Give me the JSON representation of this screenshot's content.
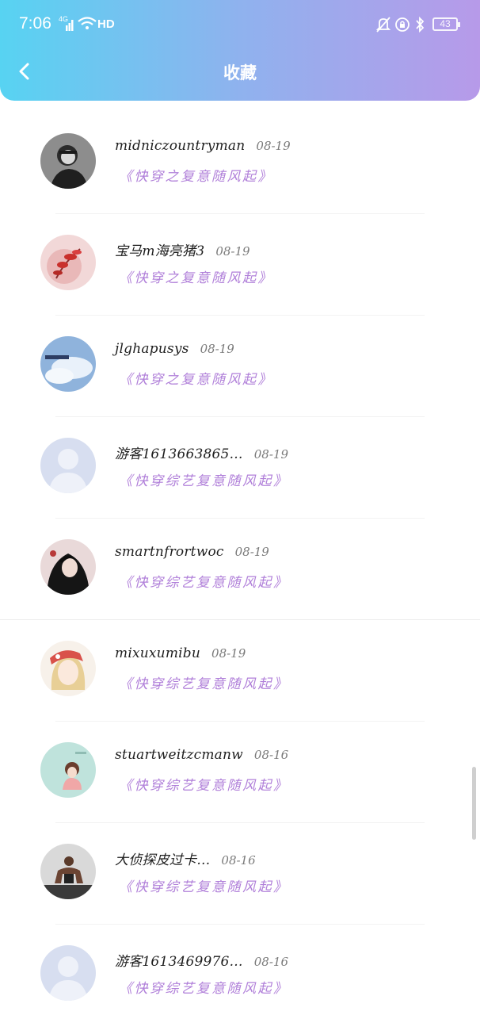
{
  "status_bar": {
    "time": "7:06",
    "network": "4G",
    "hd": "HD",
    "battery": "43"
  },
  "header": {
    "title": "收藏"
  },
  "items": [
    {
      "username": "midniczountryman",
      "date": "08-19",
      "book": "《快穿之复意随风起》",
      "avatar": "photo-woman"
    },
    {
      "username": "宝马m海亮猪3",
      "date": "08-19",
      "book": "《快穿之复意随风起》",
      "avatar": "red-leaves"
    },
    {
      "username": "jlghapusys",
      "date": "08-19",
      "book": "《快穿之复意随风起》",
      "avatar": "sky-clouds"
    },
    {
      "username": "游客1613663865…",
      "date": "08-19",
      "book": "《快穿综艺复意随风起》",
      "avatar": "default"
    },
    {
      "username": "smartnfrortwoc",
      "date": "08-19",
      "book": "《快穿综艺复意随风起》",
      "avatar": "anime-dark"
    },
    {
      "username": "mixuxumibu",
      "date": "08-19",
      "book": "《快穿综艺复意随风起》",
      "avatar": "anime-blonde"
    },
    {
      "username": "stuartweitzcmanw",
      "date": "08-16",
      "book": "《快穿综艺复意随风起》",
      "avatar": "illustration-girl"
    },
    {
      "username": "大侦探皮过卡…",
      "date": "08-16",
      "book": "《快穿综艺复意随风起》",
      "avatar": "athlete"
    },
    {
      "username": "游客1613469976…",
      "date": "08-16",
      "book": "《快穿综艺复意随风起》",
      "avatar": "default"
    }
  ]
}
